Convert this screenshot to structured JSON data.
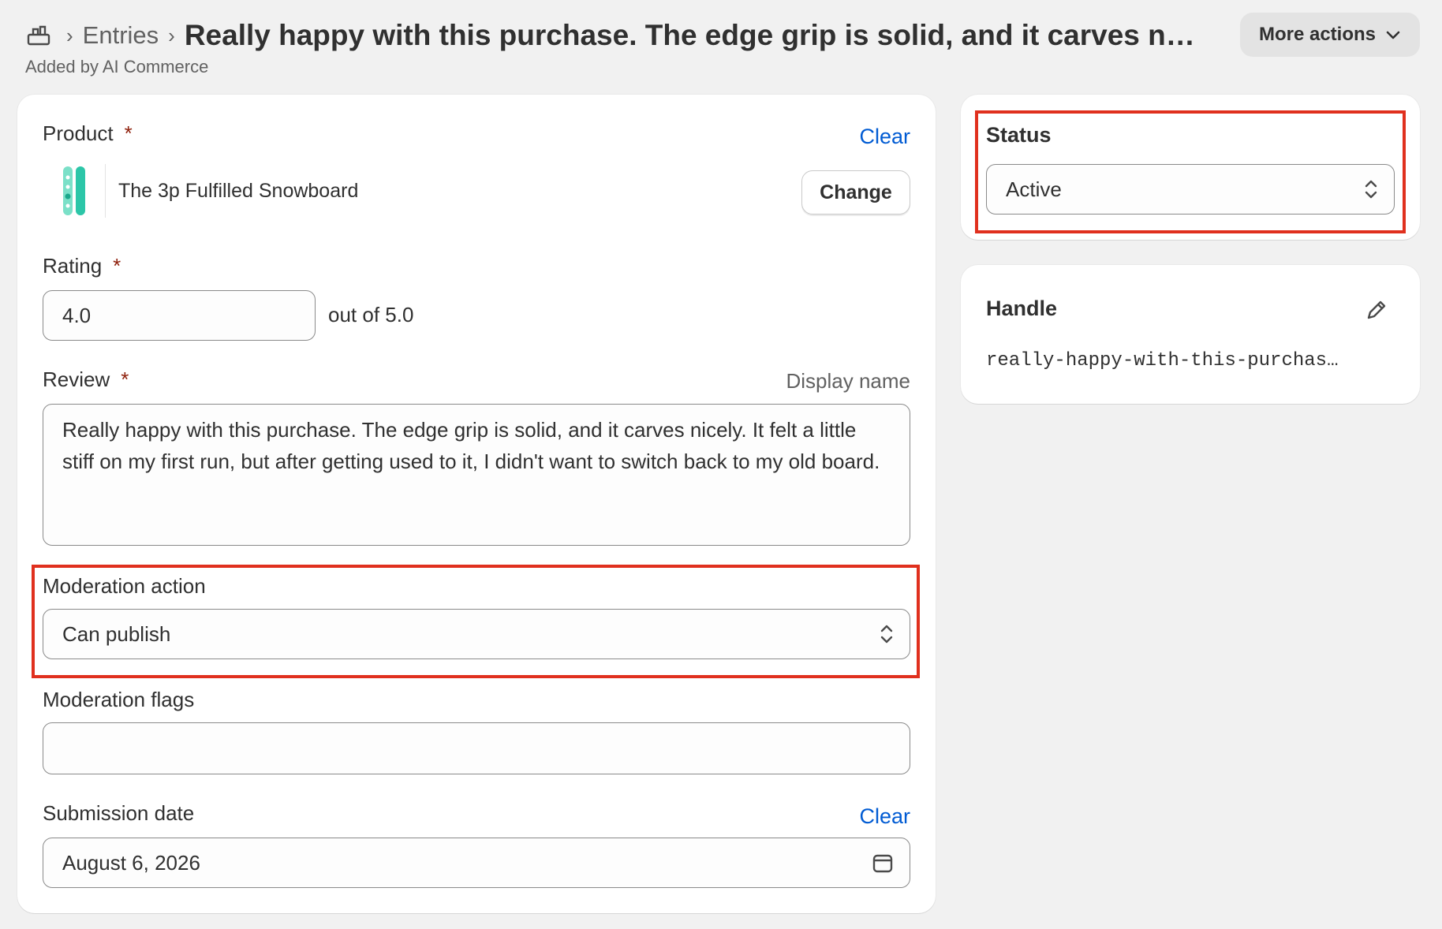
{
  "header": {
    "breadcrumb_icon": "metaobject-icon",
    "breadcrumb_entries": "Entries",
    "title": "Really happy with this purchase. The edge grip is solid, and it carves nicel...",
    "subtitle": "Added by AI Commerce",
    "more_actions_label": "More actions"
  },
  "product": {
    "label": "Product",
    "required_mark": "*",
    "clear_label": "Clear",
    "name": "The 3p Fulfilled Snowboard",
    "change_label": "Change"
  },
  "rating": {
    "label": "Rating",
    "required_mark": "*",
    "value": "4.0",
    "suffix": "out of 5.0"
  },
  "review": {
    "label": "Review",
    "required_mark": "*",
    "display_name_label": "Display name",
    "text": "Really happy with this purchase. The edge grip is solid, and it carves nicely. It felt a little stiff on my first run, but after getting used to it, I didn't want to switch back to my old board."
  },
  "moderation_action": {
    "label": "Moderation action",
    "selected": "Can publish"
  },
  "moderation_flags": {
    "label": "Moderation flags",
    "value": ""
  },
  "submission_date": {
    "label": "Submission date",
    "clear_label": "Clear",
    "value": "August 6, 2026"
  },
  "status": {
    "title": "Status",
    "selected": "Active"
  },
  "handle": {
    "title": "Handle",
    "value": "really-happy-with-this-purchas..."
  },
  "colors": {
    "background": "#f1f1f1",
    "card": "#ffffff",
    "link": "#005bd3",
    "required": "#8e1f0b",
    "highlight": "#e0301e"
  }
}
